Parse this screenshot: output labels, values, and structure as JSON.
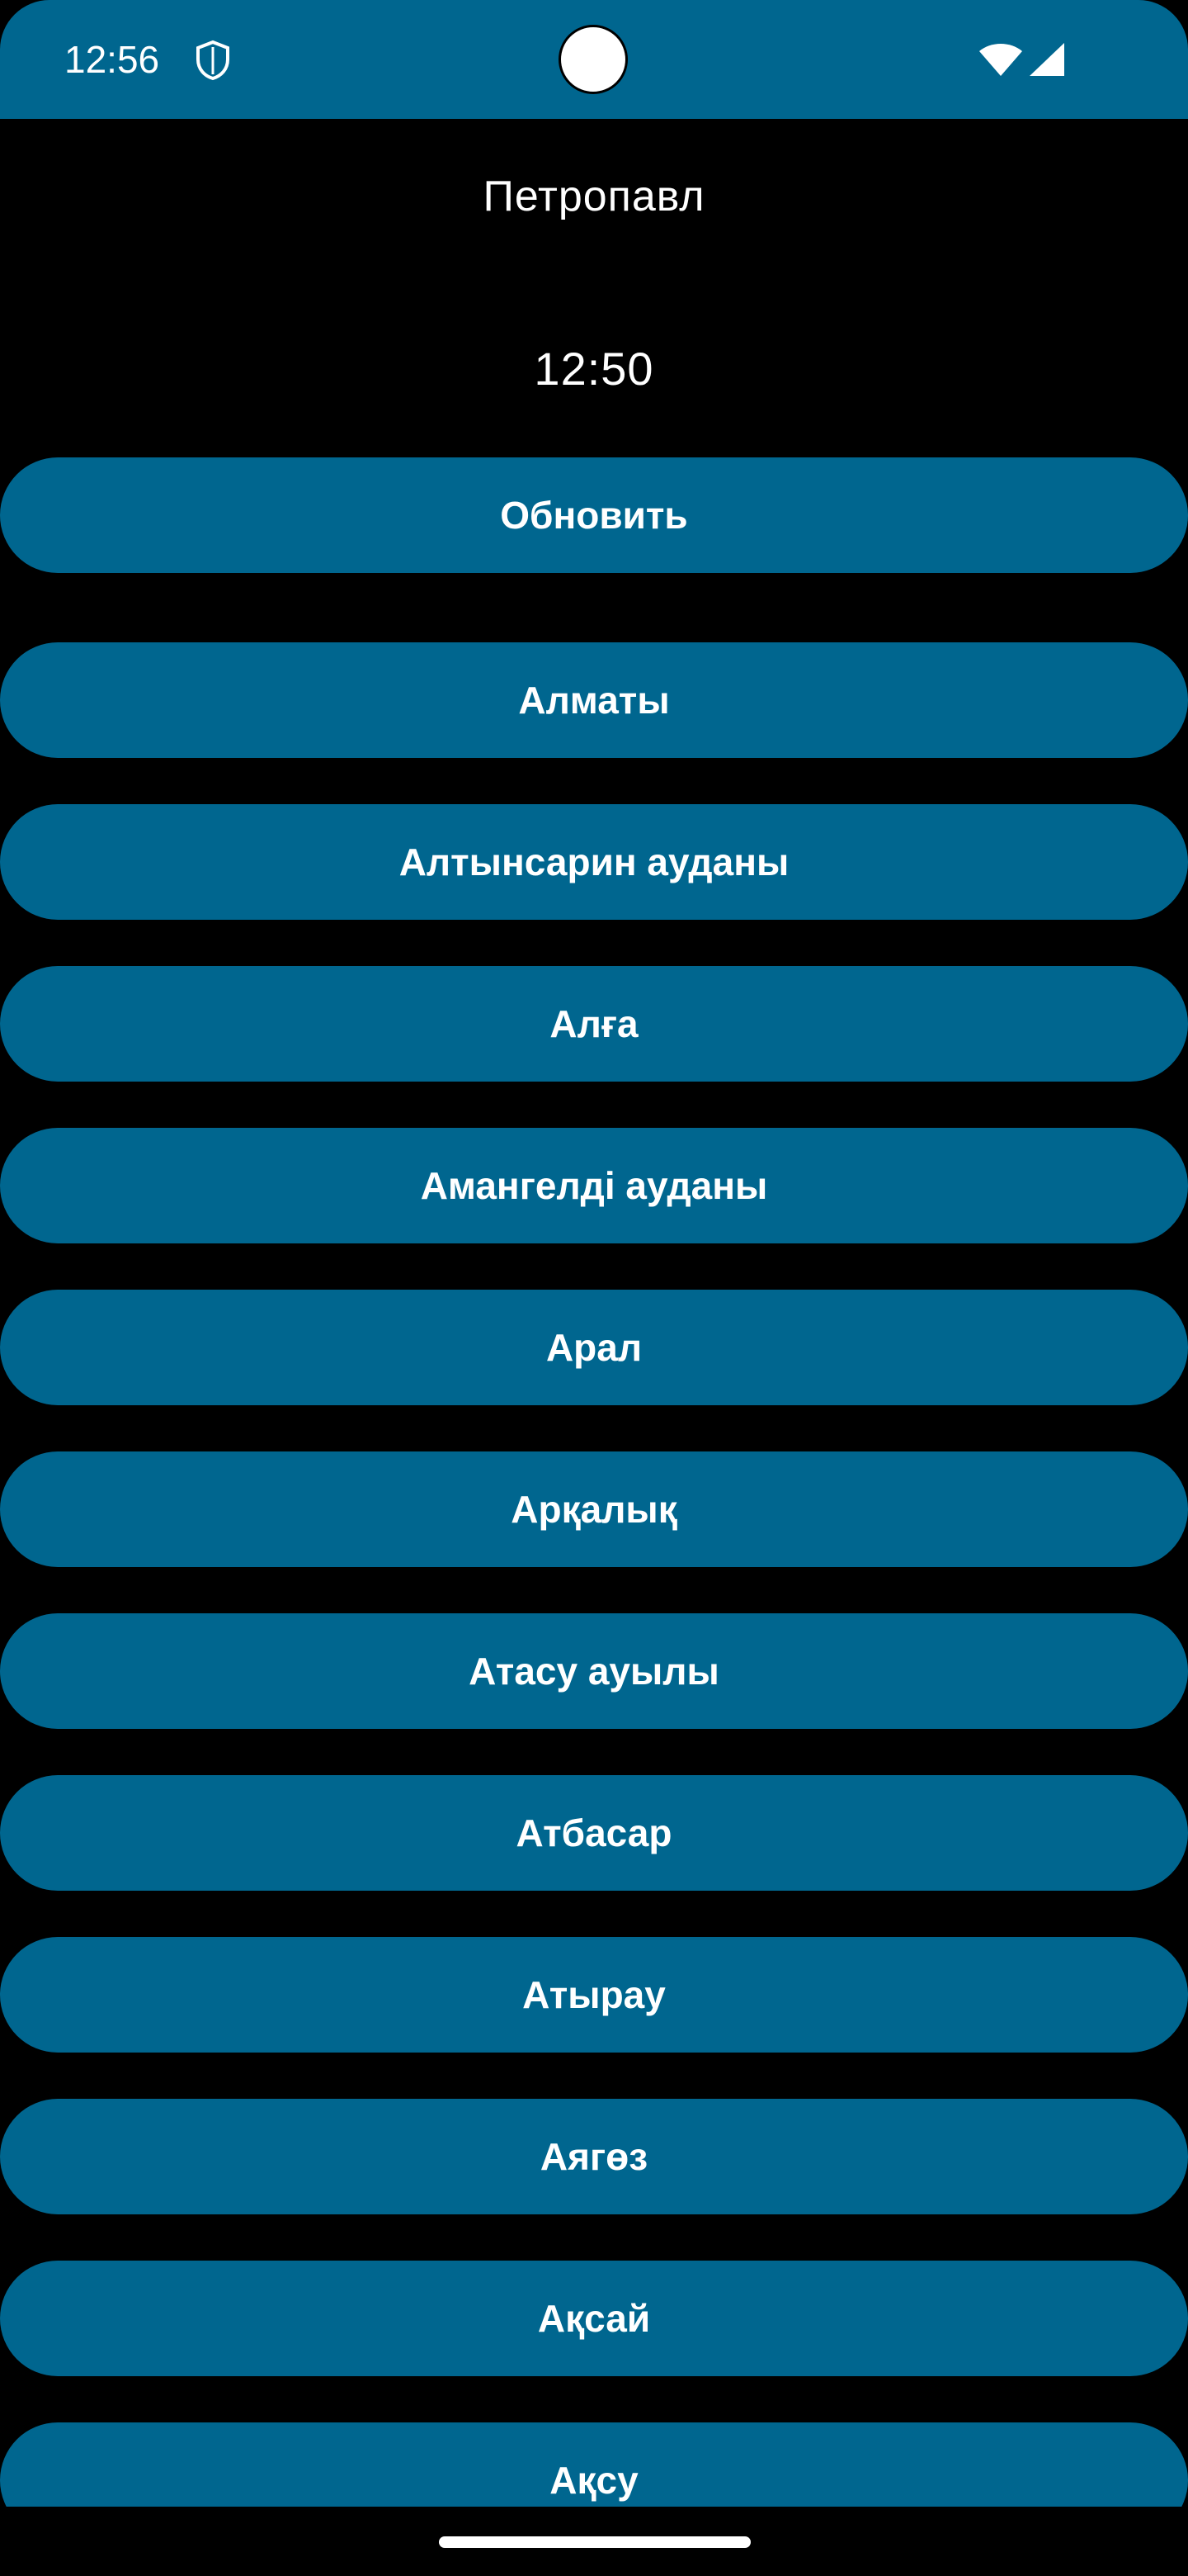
{
  "status_bar": {
    "time": "12:56",
    "background_color": "#00668f",
    "icons": [
      "shield-icon",
      "wifi-icon",
      "signal-icon"
    ]
  },
  "header": {
    "city": "Петропавл",
    "time": "12:50"
  },
  "refresh_button": {
    "label": "Обновить"
  },
  "city_list": {
    "items": [
      {
        "label": "Алматы"
      },
      {
        "label": "Алтынсарин ауданы"
      },
      {
        "label": "Алға"
      },
      {
        "label": "Амангелді ауданы"
      },
      {
        "label": "Арал"
      },
      {
        "label": "Арқалық"
      },
      {
        "label": "Атасу ауылы"
      },
      {
        "label": "Атбасар"
      },
      {
        "label": "Атырау"
      },
      {
        "label": "Аягөз"
      },
      {
        "label": "Ақсай"
      },
      {
        "label": "Ақсу"
      }
    ]
  },
  "colors": {
    "accent": "#00668f",
    "background": "#000000",
    "text": "#ffffff"
  }
}
